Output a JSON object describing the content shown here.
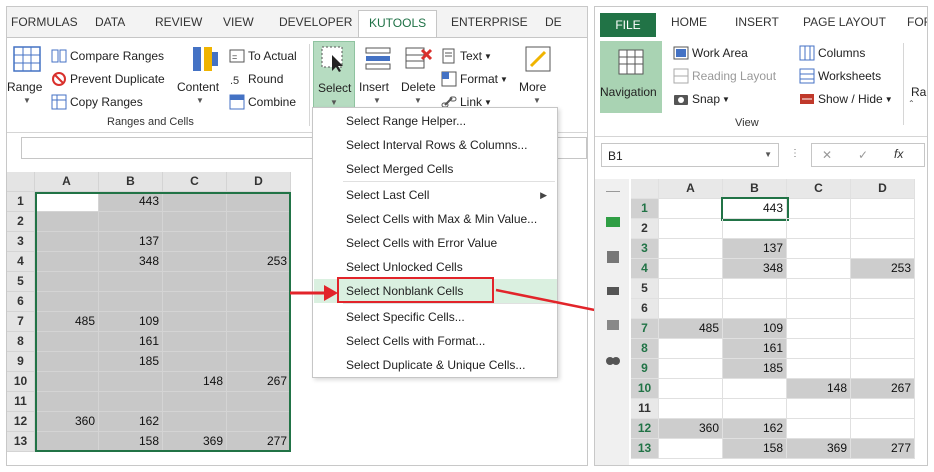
{
  "left": {
    "tabs": [
      "FORMULAS",
      "DATA",
      "REVIEW",
      "VIEW",
      "DEVELOPER",
      "KUTOOLS",
      "ENTERPRISE",
      "DE"
    ],
    "active_tab": "KUTOOLS",
    "ribbon": {
      "range_label": "Range",
      "compare_ranges": "Compare Ranges",
      "prevent_duplicate": "Prevent Duplicate",
      "copy_ranges": "Copy Ranges",
      "content_label": "Content",
      "to_actual": "To Actual",
      "round": "Round",
      "combine": "Combine",
      "group_label": "Ranges and Cells",
      "select_label": "Select",
      "insert_label": "Insert",
      "delete_label": "Delete",
      "text_label": "Text",
      "format_label": "Format",
      "link_label": "Link",
      "more_label": "More"
    },
    "columns": [
      "A",
      "B",
      "C",
      "D"
    ],
    "rows": [
      {
        "n": "1",
        "A": "",
        "B": "443",
        "C": "",
        "D": ""
      },
      {
        "n": "2",
        "A": "",
        "B": "",
        "C": "",
        "D": ""
      },
      {
        "n": "3",
        "A": "",
        "B": "137",
        "C": "",
        "D": ""
      },
      {
        "n": "4",
        "A": "",
        "B": "348",
        "C": "",
        "D": "253"
      },
      {
        "n": "5",
        "A": "",
        "B": "",
        "C": "",
        "D": ""
      },
      {
        "n": "6",
        "A": "",
        "B": "",
        "C": "",
        "D": ""
      },
      {
        "n": "7",
        "A": "485",
        "B": "109",
        "C": "",
        "D": ""
      },
      {
        "n": "8",
        "A": "",
        "B": "161",
        "C": "",
        "D": ""
      },
      {
        "n": "9",
        "A": "",
        "B": "185",
        "C": "",
        "D": ""
      },
      {
        "n": "10",
        "A": "",
        "B": "",
        "C": "148",
        "D": "267"
      },
      {
        "n": "11",
        "A": "",
        "B": "",
        "C": "",
        "D": ""
      },
      {
        "n": "12",
        "A": "360",
        "B": "162",
        "C": "",
        "D": ""
      },
      {
        "n": "13",
        "A": "",
        "B": "158",
        "C": "369",
        "D": "277"
      }
    ],
    "menu": [
      "Select Range Helper...",
      "Select Interval Rows & Columns...",
      "Select Merged Cells",
      "Select Last Cell",
      "Select Cells with Max & Min Value...",
      "Select Cells with Error Value",
      "Select Unlocked Cells",
      "Select Nonblank Cells",
      "Select Specific Cells...",
      "Select Cells with Format...",
      "Select Duplicate & Unique Cells..."
    ]
  },
  "right": {
    "tabs": [
      "FILE",
      "HOME",
      "INSERT",
      "PAGE LAYOUT",
      "FOR"
    ],
    "ribbon": {
      "navigation": "Navigation",
      "work_area": "Work Area",
      "reading_layout": "Reading Layout",
      "snap": "Snap",
      "columns": "Columns",
      "worksheets": "Worksheets",
      "show_hide": "Show / Hide",
      "view_group": "View",
      "ran": "Ran"
    },
    "name_box": "B1",
    "fx": "fx",
    "colors": {
      "accent": "#217346",
      "selection": "#cdcdcd",
      "highlight": "#e2242a"
    }
  }
}
